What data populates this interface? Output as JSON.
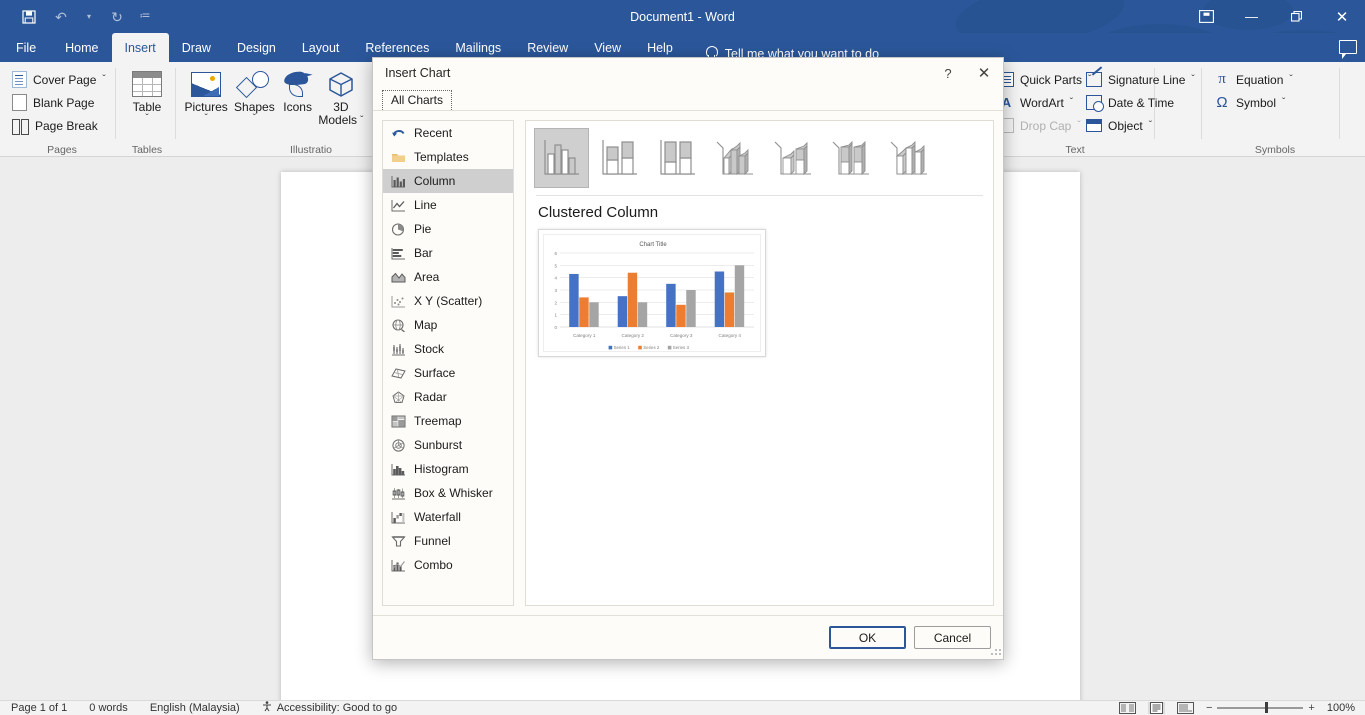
{
  "window": {
    "document_title": "Document1  -  Word",
    "quick_access": [
      {
        "name": "save",
        "glyph": "ὋE"
      },
      {
        "name": "undo",
        "glyph": "↶"
      },
      {
        "name": "redo",
        "glyph": "↻"
      },
      {
        "name": "customize",
        "glyph": "⨍"
      }
    ],
    "controls": {
      "ribbon_display": "▣",
      "minimize": "—",
      "restore": "❐",
      "close": "✕"
    },
    "comment_icon": "comment-icon"
  },
  "ribbon": {
    "tabs": [
      {
        "label": "File",
        "active": false
      },
      {
        "label": "Home",
        "active": false
      },
      {
        "label": "Insert",
        "active": true
      },
      {
        "label": "Draw",
        "active": false
      },
      {
        "label": "Design",
        "active": false
      },
      {
        "label": "Layout",
        "active": false
      },
      {
        "label": "References",
        "active": false
      },
      {
        "label": "Mailings",
        "active": false
      },
      {
        "label": "Review",
        "active": false
      },
      {
        "label": "View",
        "active": false
      },
      {
        "label": "Help",
        "active": false
      }
    ],
    "tell_me": "Tell me what you want to do",
    "groups": {
      "pages": {
        "label": "Pages",
        "items": [
          {
            "label": "Cover Page",
            "caret": "ˇ"
          },
          {
            "label": "Blank Page",
            "caret": ""
          },
          {
            "label": "Page Break",
            "caret": ""
          }
        ]
      },
      "tables": {
        "label": "Tables",
        "items": [
          {
            "label": "Table",
            "caret": "ˇ"
          }
        ]
      },
      "illustrations": {
        "label": "Illustratio",
        "items": [
          {
            "label": "Pictures",
            "caret": "ˇ"
          },
          {
            "label": "Shapes",
            "caret": "ˇ"
          },
          {
            "label": "Icons",
            "caret": ""
          },
          {
            "label": "3D\nModels",
            "line1": "3D",
            "line2": "Models",
            "caret": "ˇ"
          }
        ]
      },
      "text": {
        "label": "Text",
        "items": [
          {
            "label": "Quick Parts",
            "caret": "ˇ"
          },
          {
            "label": "WordArt",
            "caret": "ˇ"
          },
          {
            "label": "Drop Cap",
            "caret": "ˇ",
            "disabled": true
          },
          {
            "label": "Signature Line",
            "caret": "ˇ"
          },
          {
            "label": "Date & Time",
            "caret": ""
          },
          {
            "label": "Object",
            "caret": "ˇ"
          }
        ]
      },
      "symbols": {
        "label": "Symbols",
        "items": [
          {
            "label": "Equation",
            "caret": "ˇ",
            "glyph": "π"
          },
          {
            "label": "Symbol",
            "caret": "ˇ",
            "glyph": "Ω"
          }
        ]
      }
    }
  },
  "dialog": {
    "title": "Insert Chart",
    "help_button": "?",
    "close_button": "✕",
    "tabs": [
      {
        "label": "All Charts",
        "active": true
      }
    ],
    "chart_types": [
      {
        "label": "Recent",
        "icon": "recent-icon",
        "selected": false
      },
      {
        "label": "Templates",
        "icon": "templates-folder-icon",
        "selected": false
      },
      {
        "label": "Column",
        "icon": "column-chart-icon",
        "selected": true
      },
      {
        "label": "Line",
        "icon": "line-chart-icon",
        "selected": false
      },
      {
        "label": "Pie",
        "icon": "pie-chart-icon",
        "selected": false
      },
      {
        "label": "Bar",
        "icon": "bar-chart-icon",
        "selected": false
      },
      {
        "label": "Area",
        "icon": "area-chart-icon",
        "selected": false
      },
      {
        "label": "X Y (Scatter)",
        "icon": "scatter-chart-icon",
        "selected": false
      },
      {
        "label": "Map",
        "icon": "map-chart-icon",
        "selected": false
      },
      {
        "label": "Stock",
        "icon": "stock-chart-icon",
        "selected": false
      },
      {
        "label": "Surface",
        "icon": "surface-chart-icon",
        "selected": false
      },
      {
        "label": "Radar",
        "icon": "radar-chart-icon",
        "selected": false
      },
      {
        "label": "Treemap",
        "icon": "treemap-chart-icon",
        "selected": false
      },
      {
        "label": "Sunburst",
        "icon": "sunburst-chart-icon",
        "selected": false
      },
      {
        "label": "Histogram",
        "icon": "histogram-chart-icon",
        "selected": false
      },
      {
        "label": "Box & Whisker",
        "icon": "box-whisker-chart-icon",
        "selected": false
      },
      {
        "label": "Waterfall",
        "icon": "waterfall-chart-icon",
        "selected": false
      },
      {
        "label": "Funnel",
        "icon": "funnel-chart-icon",
        "selected": false
      },
      {
        "label": "Combo",
        "icon": "combo-chart-icon",
        "selected": false
      }
    ],
    "subtypes": [
      {
        "name": "clustered-column",
        "selected": true
      },
      {
        "name": "stacked-column",
        "selected": false
      },
      {
        "name": "100-percent-stacked-column",
        "selected": false
      },
      {
        "name": "3d-clustered-column",
        "selected": false
      },
      {
        "name": "3d-stacked-column",
        "selected": false
      },
      {
        "name": "3d-100-percent-stacked-column",
        "selected": false
      },
      {
        "name": "3d-column",
        "selected": false
      }
    ],
    "preview_title": "Clustered Column",
    "buttons": {
      "ok": "OK",
      "cancel": "Cancel"
    }
  },
  "chart_data": {
    "type": "bar",
    "title": "Chart Title",
    "categories": [
      "Category 1",
      "Category 2",
      "Category 3",
      "Category 4"
    ],
    "series": [
      {
        "name": "Series 1",
        "values": [
          4.3,
          2.5,
          3.5,
          4.5
        ],
        "color": "#4472c4"
      },
      {
        "name": "Series 2",
        "values": [
          2.4,
          4.4,
          1.8,
          2.8
        ],
        "color": "#ed7d31"
      },
      {
        "name": "Series 3",
        "values": [
          2,
          2,
          3,
          5
        ],
        "color": "#a5a5a5"
      }
    ],
    "ylim": [
      0,
      6
    ],
    "yticks": [
      0,
      1,
      2,
      3,
      4,
      5,
      6
    ],
    "xlabel": "",
    "ylabel": "",
    "grid": true,
    "legend_position": "bottom"
  },
  "status_bar": {
    "page": "Page 1 of 1",
    "words": "0 words",
    "language": "English (Malaysia)",
    "accessibility": "Accessibility: Good to go",
    "view_modes": [
      "read-mode-icon",
      "print-layout-icon",
      "web-layout-icon"
    ],
    "zoom_out": "−",
    "zoom_in": "+",
    "zoom_level": "100%"
  }
}
